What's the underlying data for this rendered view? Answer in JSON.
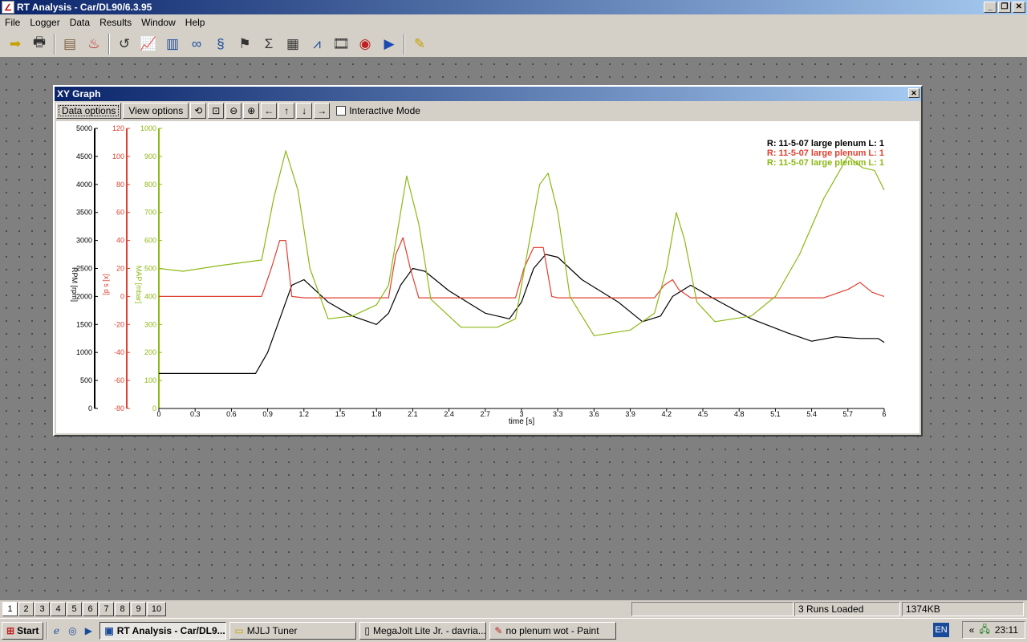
{
  "app": {
    "title": "RT Analysis - Car/DL90/6.3.95",
    "icon": "rt-analysis-app-icon"
  },
  "window_buttons": {
    "minimize": "_",
    "restore": "❐",
    "close": "✕"
  },
  "menu": [
    "File",
    "Logger",
    "Data",
    "Results",
    "Window",
    "Help"
  ],
  "toolbar_icons": [
    "open-file-icon",
    "printer-icon",
    "clipboard-icon",
    "logger-icon",
    "track-map-icon",
    "graph-icon",
    "bar-chart-icon",
    "video-link-icon",
    "circuit-icon",
    "lap-flag-icon",
    "sum-icon",
    "table-icon",
    "multi-graph-icon",
    "film-icon",
    "gauge-icon",
    "play-icon",
    "help-icon"
  ],
  "xy_window": {
    "title": "XY Graph",
    "close": "✕",
    "data_options": "Data options",
    "view_options": "View options",
    "tool_icons": [
      "zoom-reset-icon",
      "zoom-box-icon",
      "zoom-out-icon",
      "zoom-select-icon",
      "pan-left-icon",
      "pan-up-icon",
      "pan-down-icon",
      "pan-right-icon"
    ],
    "interactive_mode": "Interactive Mode"
  },
  "chart_data": {
    "type": "line",
    "xlabel": "time [s]",
    "xlim": [
      0,
      6
    ],
    "xticks": [
      "0",
      "0.3",
      "0.6",
      "0.9",
      "1.2",
      "1.5",
      "1.8",
      "2.1",
      "2.4",
      "2.7",
      "3",
      "3.3",
      "3.6",
      "3.9",
      "4.2",
      "4.5",
      "4.8",
      "5.1",
      "5.4",
      "5.7",
      "6"
    ],
    "grid": false,
    "legend_position": "top-right",
    "legend": [
      {
        "text": "R: 11-5-07 large plenum  L: 1",
        "color": "#000000"
      },
      {
        "text": "R: 11-5-07 large plenum  L: 1",
        "color": "#e04030"
      },
      {
        "text": "R: 11-5-07 large plenum  L: 1",
        "color": "#8cb814"
      }
    ],
    "axes": [
      {
        "label": "RPM [rpm]",
        "color": "#000000",
        "ylim": [
          0,
          5000
        ],
        "ticks": [
          "0",
          "500",
          "1000",
          "1500",
          "2000",
          "2500",
          "3000",
          "3500",
          "4000",
          "4500",
          "5000"
        ]
      },
      {
        "label": "[x] s d]",
        "color": "#e04030",
        "ylim": [
          -80,
          120
        ],
        "ticks": [
          "-80",
          "-60",
          "-40",
          "-20",
          "0",
          "20",
          "40",
          "60",
          "80",
          "100",
          "120"
        ]
      },
      {
        "label": "MAP [mbar]",
        "color": "#8cb814",
        "ylim": [
          0,
          1000
        ],
        "ticks": [
          "0",
          "100",
          "200",
          "300",
          "400",
          "500",
          "600",
          "700",
          "800",
          "900",
          "1000"
        ]
      }
    ],
    "series": [
      {
        "axis": 0,
        "color": "#000000",
        "x": [
          0,
          0.8,
          0.9,
          1.0,
          1.1,
          1.2,
          1.4,
          1.6,
          1.8,
          1.9,
          2.0,
          2.1,
          2.2,
          2.4,
          2.7,
          2.9,
          3.0,
          3.1,
          3.2,
          3.3,
          3.5,
          3.8,
          4.0,
          4.15,
          4.25,
          4.4,
          4.6,
          4.9,
          5.2,
          5.4,
          5.6,
          5.8,
          5.95,
          6.0
        ],
        "y": [
          625,
          625,
          1000,
          1600,
          2200,
          2300,
          1900,
          1650,
          1500,
          1700,
          2200,
          2500,
          2450,
          2100,
          1700,
          1600,
          1900,
          2500,
          2750,
          2700,
          2300,
          1900,
          1550,
          1650,
          2000,
          2200,
          1950,
          1600,
          1350,
          1200,
          1280,
          1250,
          1250,
          1180
        ]
      },
      {
        "axis": 1,
        "color": "#e04030",
        "x": [
          0,
          0.85,
          0.93,
          1.0,
          1.05,
          1.1,
          1.2,
          1.9,
          1.96,
          2.02,
          2.08,
          2.15,
          2.2,
          2.95,
          3.02,
          3.1,
          3.18,
          3.25,
          3.3,
          4.1,
          4.18,
          4.25,
          4.3,
          4.4,
          5.5,
          5.7,
          5.8,
          5.9,
          6.0
        ],
        "y": [
          0,
          0,
          20,
          40,
          40,
          0,
          -1,
          -1,
          30,
          42,
          20,
          -1,
          -1,
          -1,
          20,
          35,
          35,
          0,
          -1,
          -1,
          8,
          12,
          5,
          -1,
          -1,
          5,
          10,
          3,
          0
        ]
      },
      {
        "axis": 2,
        "color": "#8cb814",
        "x": [
          0,
          0.2,
          0.5,
          0.85,
          0.95,
          1.05,
          1.15,
          1.25,
          1.4,
          1.6,
          1.8,
          1.9,
          2.0,
          2.05,
          2.15,
          2.25,
          2.5,
          2.8,
          2.95,
          3.05,
          3.15,
          3.22,
          3.3,
          3.4,
          3.6,
          3.9,
          4.1,
          4.2,
          4.28,
          4.35,
          4.45,
          4.6,
          4.9,
          5.1,
          5.3,
          5.5,
          5.7,
          5.82,
          5.92,
          6.0
        ],
        "y": [
          500,
          490,
          510,
          530,
          750,
          920,
          780,
          500,
          320,
          330,
          370,
          440,
          700,
          830,
          660,
          390,
          290,
          290,
          320,
          560,
          800,
          840,
          700,
          400,
          260,
          280,
          340,
          500,
          700,
          600,
          380,
          310,
          330,
          400,
          550,
          750,
          900,
          860,
          850,
          780
        ]
      }
    ]
  },
  "bottom": {
    "tabs": [
      "1",
      "2",
      "3",
      "4",
      "5",
      "6",
      "7",
      "8",
      "9",
      "10"
    ],
    "status_runs": "3 Runs Loaded",
    "status_mem": "1374KB"
  },
  "taskbar": {
    "start": "Start",
    "quicklaunch": [
      "ie-icon",
      "explorer-icon",
      "media-player-icon"
    ],
    "tasks": [
      {
        "label": "RT Analysis - Car/DL9...",
        "icon": "rt-analysis-icon"
      },
      {
        "label": "MJLJ Tuner",
        "icon": "folder-icon"
      },
      {
        "label": "MegaJolt Lite Jr. - davria...",
        "icon": "document-icon"
      },
      {
        "label": "no plenum wot - Paint",
        "icon": "paint-icon"
      }
    ],
    "lang": "EN",
    "tray_arrows": "«",
    "time": "23:11"
  }
}
